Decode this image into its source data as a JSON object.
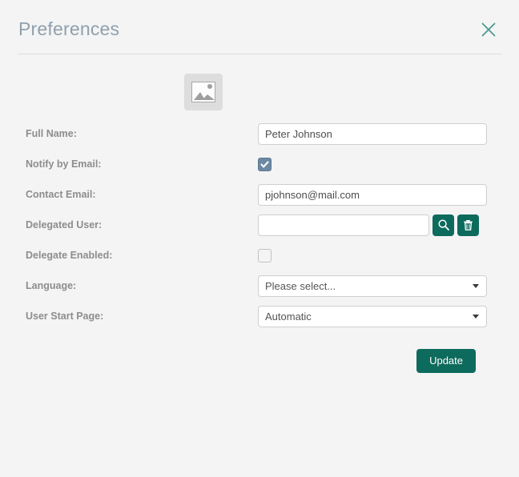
{
  "dialog": {
    "title": "Preferences",
    "close_label": "Close",
    "close_icon": "close-icon"
  },
  "avatar": {
    "icon": "image-placeholder-icon",
    "alt": "User photo placeholder"
  },
  "form": {
    "rows": [
      {
        "label": "Full Name:",
        "type": "text",
        "value": "Peter Johnson",
        "placeholder": ""
      },
      {
        "label": "Notify by Email:",
        "type": "checkbox",
        "checked": true
      },
      {
        "label": "Contact Email:",
        "type": "text",
        "value": "pjohnson@mail.com",
        "placeholder": ""
      },
      {
        "label": "Delegated User:",
        "type": "text-with-buttons",
        "value": "",
        "placeholder": ""
      },
      {
        "label": "Delegate Enabled:",
        "type": "checkbox",
        "checked": false
      },
      {
        "label": "Language:",
        "type": "select",
        "value": "Please select..."
      },
      {
        "label": "User Start Page:",
        "type": "select",
        "value": "Automatic"
      }
    ],
    "full_name": {
      "label": "Full Name:",
      "value": "Peter Johnson"
    },
    "notify_by_email": {
      "label": "Notify by Email:",
      "checked": true
    },
    "contact_email": {
      "label": "Contact Email:",
      "value": "pjohnson@mail.com"
    },
    "delegated_user": {
      "label": "Delegated User:",
      "value": "",
      "placeholder": "",
      "search_icon": "search-icon",
      "delete_icon": "trash-icon"
    },
    "delegate_enabled": {
      "label": "Delegate Enabled:",
      "checked": false
    },
    "language": {
      "label": "Language:",
      "value": "Please select..."
    },
    "user_start_page": {
      "label": "User Start Page:",
      "value": "Automatic"
    }
  },
  "footer": {
    "update_label": "Update"
  },
  "colors": {
    "accent_green": "#0d6b5d",
    "close_teal": "#4a9a91",
    "title_text": "#8fa0ae",
    "label_text": "#8d8d8d",
    "checkbox_blue": "#6c88a2",
    "background": "#f4f4f4"
  }
}
